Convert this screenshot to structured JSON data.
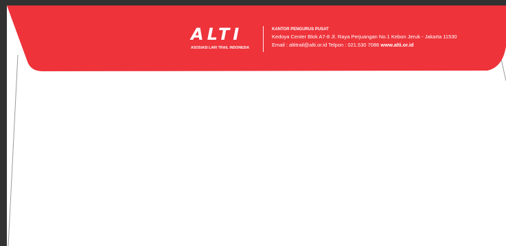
{
  "letterhead": {
    "logo_text": "ALTI",
    "logo_tagline": "ASOSIASI LARI TRAIL INDONESIA",
    "office_title": "KANTOR PENGURUS PUSAT",
    "address": "Kedoya Center Blok A7-8 Jl. Raya Perjuangan No.1 Kebon Jeruk - Jakarta 11530",
    "contact": "Email : altitrail@alti.or.id Telpon : 021.530 7086",
    "website": "www.alti.or.id"
  },
  "colors": {
    "flap": "#ee333b",
    "paper": "#ffffff",
    "background": "#323232"
  }
}
